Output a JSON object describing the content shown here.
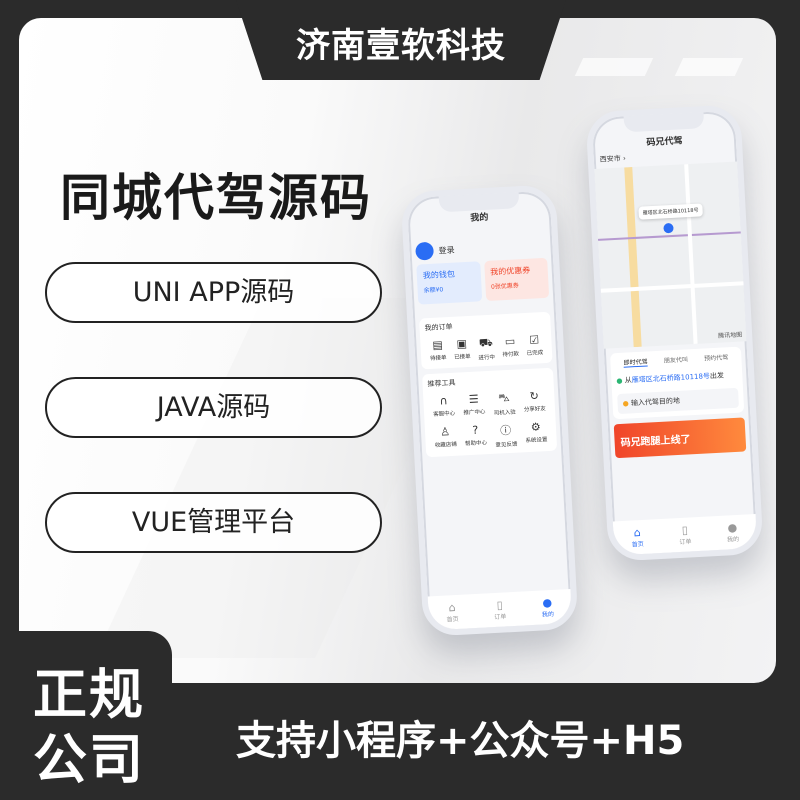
{
  "brand": "济南壹软科技",
  "title": "同城代驾源码",
  "features": [
    "UNI APP源码",
    "JAVA源码",
    "VUE管理平台"
  ],
  "badge": [
    "正规",
    "公司"
  ],
  "support": "支持小程序+公众号+H5",
  "left_phone": {
    "header": "我的",
    "login": "登录",
    "wallet": {
      "title": "我的钱包",
      "sub": "余额¥0"
    },
    "coupon": {
      "title": "我的优惠券",
      "sub": "0张优惠券"
    },
    "orders_title": "我的订单",
    "orders": [
      {
        "icon": "clipboard-icon",
        "label": "待接单"
      },
      {
        "icon": "box-icon",
        "label": "已接单"
      },
      {
        "icon": "truck-icon",
        "label": "进行中"
      },
      {
        "icon": "wallet-icon",
        "label": "待付款"
      },
      {
        "icon": "check-icon",
        "label": "已完成"
      }
    ],
    "tools_title": "推荐工具",
    "tools": [
      {
        "icon": "headset-icon",
        "label": "客服中心"
      },
      {
        "icon": "stack-icon",
        "label": "推广中心"
      },
      {
        "icon": "car-icon",
        "label": "司机入驻"
      },
      {
        "icon": "share-icon",
        "label": "分享好友"
      },
      {
        "icon": "user-icon",
        "label": "收藏店铺"
      },
      {
        "icon": "help-icon",
        "label": "帮助中心"
      },
      {
        "icon": "info-icon",
        "label": "意见反馈"
      },
      {
        "icon": "settings-icon",
        "label": "系统设置"
      }
    ],
    "tabs": [
      "首页",
      "订单",
      "我的"
    ]
  },
  "right_phone": {
    "header": "码兄代驾",
    "city": "西安市 ›",
    "pickup_tip": "雁塔区北石桥路10118号",
    "service_tabs": [
      "即时代驾",
      "朋友代叫",
      "预约代驾"
    ],
    "from_prefix": "从",
    "from_addr": "雁塔区北石桥路10118号",
    "from_suffix": "出发",
    "destination": "输入代驾目的地",
    "banner": "码兄跑腿上线了",
    "map_brand": "腾讯地图",
    "tabs": [
      "首页",
      "订单",
      "我的"
    ]
  },
  "colors": {
    "dark": "#2b2b2b",
    "accent": "#2a6df4",
    "banner": "#f0452a"
  }
}
